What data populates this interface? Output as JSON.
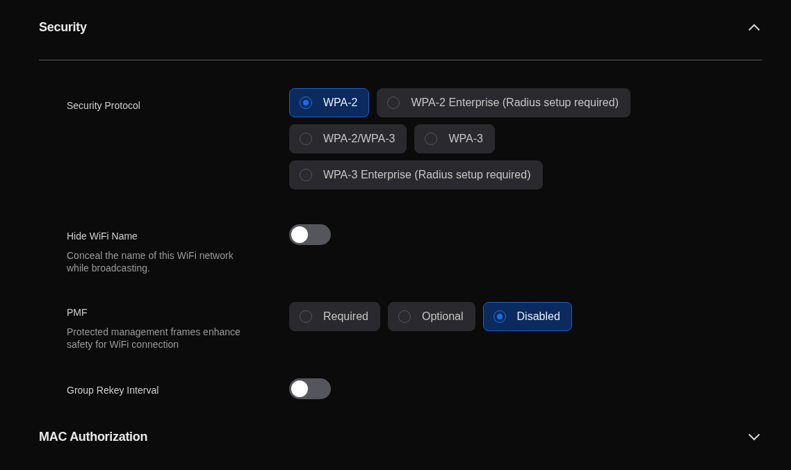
{
  "sections": [
    {
      "title": "Security",
      "expanded": true,
      "settings": [
        {
          "kind": "radio",
          "label": "Security Protocol",
          "options": [
            {
              "label": "WPA-2",
              "selected": true
            },
            {
              "label": "WPA-2 Enterprise (Radius setup required)",
              "selected": false
            },
            {
              "label": "WPA-2/WPA-3",
              "selected": false
            },
            {
              "label": "WPA-3",
              "selected": false
            },
            {
              "label": "WPA-3 Enterprise (Radius setup required)",
              "selected": false
            }
          ]
        },
        {
          "kind": "toggle",
          "label": "Hide WiFi Name",
          "description": "Conceal the name of this WiFi network while broadcasting.",
          "on": false
        },
        {
          "kind": "radio",
          "label": "PMF",
          "description": "Protected management frames enhance safety for WiFi connection",
          "options": [
            {
              "label": "Required",
              "selected": false
            },
            {
              "label": "Optional",
              "selected": false
            },
            {
              "label": "Disabled",
              "selected": true
            }
          ]
        },
        {
          "kind": "toggle",
          "label": "Group Rekey Interval",
          "on": false
        }
      ]
    },
    {
      "title": "MAC Authorization",
      "expanded": false
    }
  ]
}
